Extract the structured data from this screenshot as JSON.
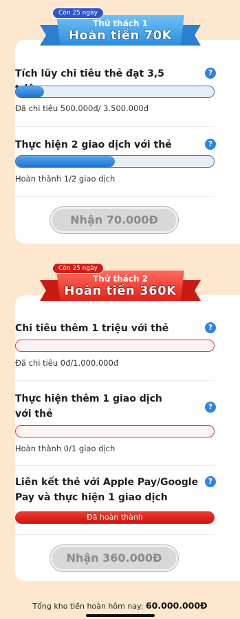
{
  "challenge1": {
    "badge": "Còn 25 ngày",
    "subtitle": "Thử thách 1",
    "title": "Hoàn tiền 70K",
    "tasks": [
      {
        "title": "Tích lũy chi tiêu thẻ đạt 3,5 triệu",
        "note": "Đã chi tiêu 500.000đ/ 3.500.000đ",
        "progress": 0.143
      },
      {
        "title": "Thực hiện 2 giao dịch với thẻ",
        "note": "Hoàn thành 1/2 giao dịch",
        "progress": 0.5
      }
    ],
    "claim_label": "Nhận 70.000Đ"
  },
  "challenge2": {
    "badge": "Còn 25 ngày",
    "subtitle": "Thử thách 2",
    "title": "Hoàn tiền 360K",
    "tasks": [
      {
        "title": "Chi tiêu thêm 1 triệu với thẻ",
        "note": "Đã chi tiêu 0đ/1.000.000đ",
        "progress": 0
      },
      {
        "title": "Thực hiện thêm 1 giao dịch với thẻ",
        "note": "Hoàn thành 0/1 giao dịch",
        "progress": 0
      },
      {
        "title": "Liên kết thẻ với Apple Pay/Google Pay và thực hiện 1 giao dịch",
        "status": "Đã hoàn thành",
        "progress": 1
      }
    ],
    "claim_label": "Nhận 360.000Đ"
  },
  "help_glyph": "?",
  "footer": {
    "label": "Tổng kho tiền hoàn hôm nay:",
    "amount": "60.000.000Đ"
  },
  "colors": {
    "background": "#fde8cf",
    "blue": "#2a83e6",
    "red": "#e2231a"
  }
}
